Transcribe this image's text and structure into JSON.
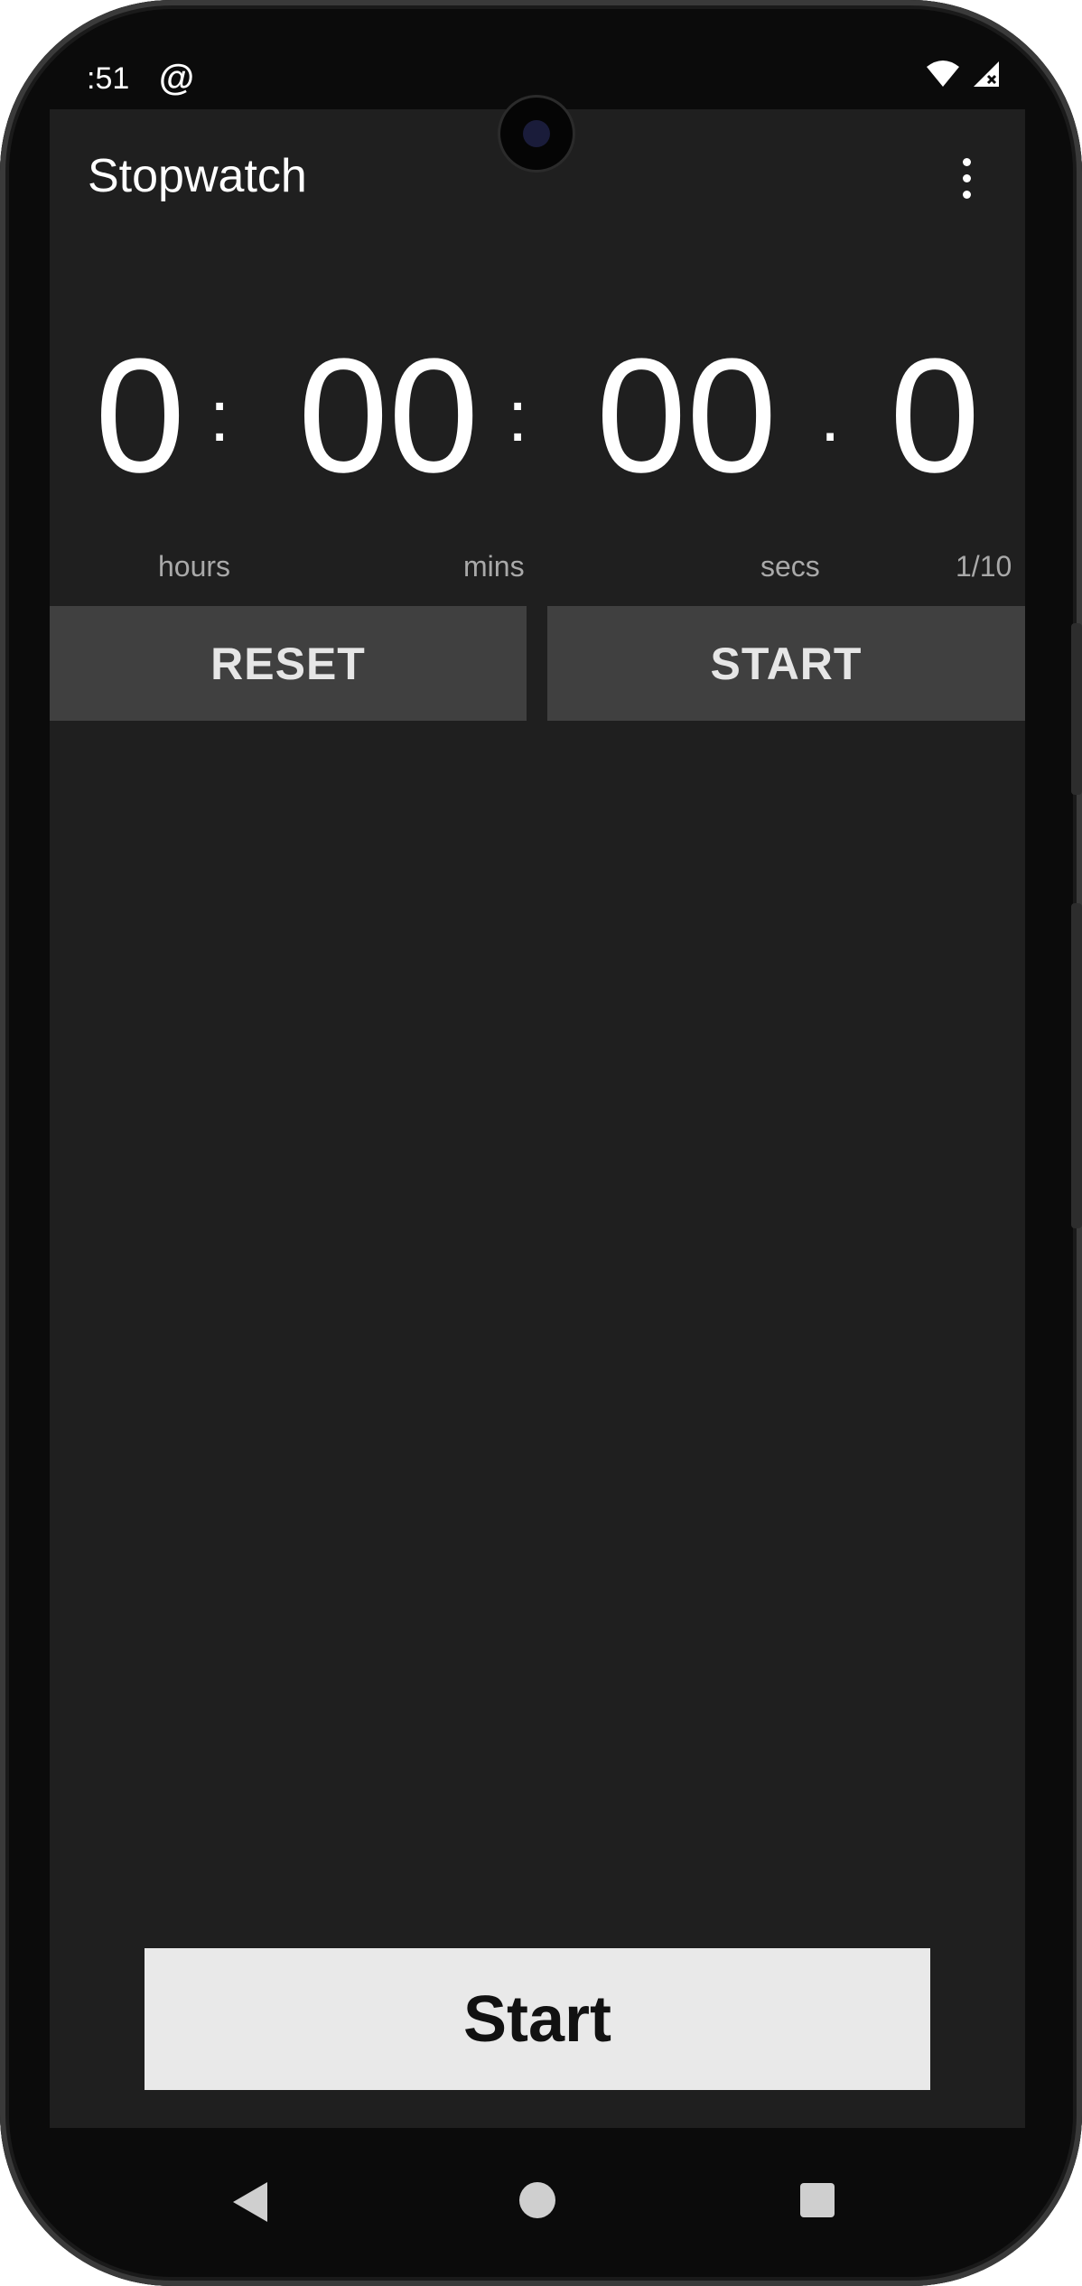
{
  "status_bar": {
    "time": ":51",
    "icons": [
      "at-sign-icon",
      "wifi-icon",
      "no-signal-icon"
    ]
  },
  "app": {
    "title": "Stopwatch",
    "menu_icon": "more-vert-icon"
  },
  "timer": {
    "hours": "0",
    "minutes": "00",
    "seconds": "00",
    "tenths": "0",
    "separator_1": ":",
    "separator_2": ":",
    "separator_3": "."
  },
  "units": {
    "hours": "hours",
    "mins": "mins",
    "secs": "secs",
    "tenths": "1/10"
  },
  "buttons": {
    "reset": "RESET",
    "start": "START",
    "big_start": "Start"
  },
  "navigation": {
    "back": "back-icon",
    "home": "home-icon",
    "recents": "recents-icon"
  },
  "colors": {
    "background": "#1f1f1f",
    "button": "#404040",
    "big_button": "#e9e9e9",
    "text": "#ffffff",
    "unit_text": "#a9a9a9"
  }
}
